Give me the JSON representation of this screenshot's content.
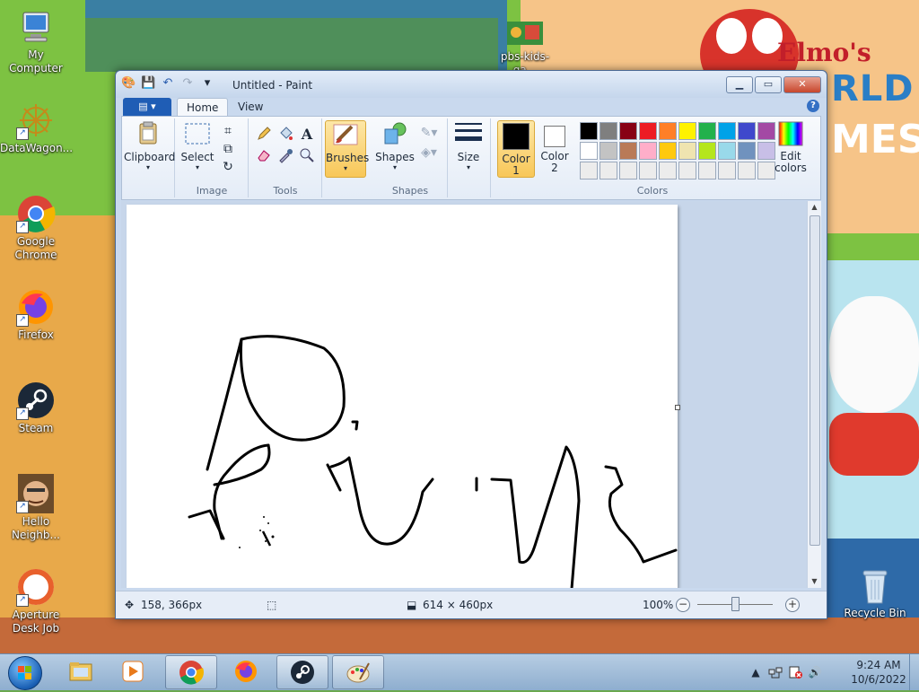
{
  "desktop": {
    "wallpaper": {
      "elmo_text_1": "Elmo's",
      "elmo_text_2": "RLD",
      "elmo_text_3": "MES"
    },
    "icons": [
      {
        "label": "My Computer",
        "icon": "computer-icon"
      },
      {
        "label": "DataWagon...",
        "icon": "datawagon-icon"
      },
      {
        "label": "Google Chrome",
        "icon": "chrome-icon"
      },
      {
        "label": "Firefox",
        "icon": "firefox-icon"
      },
      {
        "label": "Steam",
        "icon": "steam-icon"
      },
      {
        "label": "Hello Neighb...",
        "icon": "hello-neighbor-icon"
      },
      {
        "label": "Aperture Desk Job",
        "icon": "aperture-icon"
      },
      {
        "label": "pbs-kids-ga...",
        "icon": "pbs-kids-icon"
      },
      {
        "label": "Recycle Bin",
        "icon": "recycle-bin-icon"
      }
    ]
  },
  "paint": {
    "title": "Untitled - Paint",
    "tabs": {
      "home": "Home",
      "view": "View"
    },
    "ribbon": {
      "clipboard_label": "Clipboard",
      "select_label": "Select",
      "image_group": "Image",
      "tools_group": "Tools",
      "brushes_label": "Brushes",
      "shapes_label": "Shapes",
      "shapes_group": "Shapes",
      "size_label": "Size",
      "color1_label_a": "Color",
      "color1_label_b": "1",
      "color2_label_a": "Color",
      "color2_label_b": "2",
      "colors_group": "Colors",
      "edit_colors_a": "Edit",
      "edit_colors_b": "colors",
      "text_tool": "A"
    },
    "color1": "#000000",
    "color2": "#ffffff",
    "palette": [
      [
        "#000000",
        "#7f7f7f",
        "#880015",
        "#ed1c24",
        "#ff7f27",
        "#fff200",
        "#22b14c",
        "#00a2e8",
        "#3f48cc",
        "#a349a4"
      ],
      [
        "#ffffff",
        "#c3c3c3",
        "#b97a57",
        "#ffaec9",
        "#ffc90e",
        "#efe4b0",
        "#b5e61d",
        "#99d9ea",
        "#7092be",
        "#c8bfe7"
      ],
      [
        "#ececec",
        "#ececec",
        "#ececec",
        "#ececec",
        "#ececec",
        "#ececec",
        "#ececec",
        "#ececec",
        "#ececec",
        "#ececec"
      ]
    ],
    "status": {
      "cursor_pos": "158, 366px",
      "canvas_size": "614 × 460px",
      "zoom": "100%",
      "zoom_level": 1.0
    }
  },
  "taskbar": {
    "time": "9:24 AM",
    "date": "10/6/2022",
    "apps": [
      "explorer-icon",
      "media-player-icon",
      "chrome-icon",
      "firefox-icon",
      "steam-icon",
      "paint-icon"
    ]
  }
}
